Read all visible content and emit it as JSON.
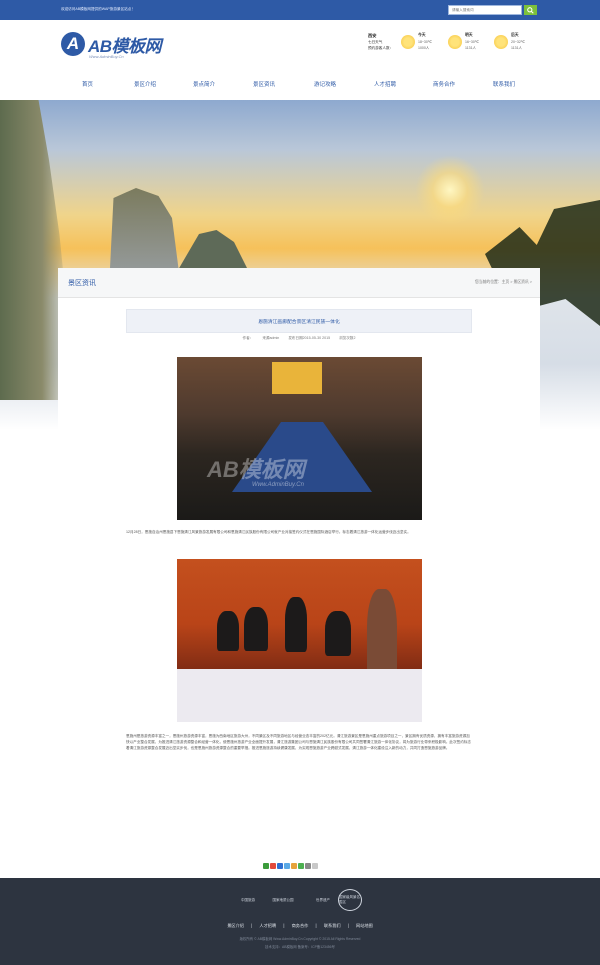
{
  "topbar": {
    "welcome": "欢迎访问AB模板网提供的WAP旅游景区站点！",
    "search_placeholder": "请输入搜索词"
  },
  "logo": {
    "name": "AB模板网",
    "url": "Www.AdminBuy.Cn"
  },
  "weather": {
    "city": "西安",
    "city_sub": "七日天气",
    "hint": "预约游客人数：",
    "days": [
      {
        "label": "今天",
        "temp": "18~30℃",
        "visitors": "1000人"
      },
      {
        "label": "明天",
        "temp": "16~30℃",
        "visitors": "1131人"
      },
      {
        "label": "后天",
        "temp": "20~32℃",
        "visitors": "1131人"
      }
    ]
  },
  "nav": [
    "首页",
    "景区介绍",
    "景点简介",
    "景区资讯",
    "游记攻略",
    "人才招聘",
    "商务合作",
    "联系我们"
  ],
  "section": {
    "title": "景区资讯",
    "breadcrumb": "您当前的位置：主页 > 景区资讯 >"
  },
  "article": {
    "title": "恩施清江画廊配合景区清江民族一体化",
    "meta": [
      "作者：",
      "来源admin",
      "发布日期2015-05-30 2015",
      "浏览次数2"
    ],
    "photo1_watermark": "AB模板网",
    "photo1_watermark_url": "Www.AdminBuy.Cn",
    "para1": "12月28日，恩施自治州恩施县下恩施清江风景旅游发展有限公司和恩施清江民族股份有限公司就产业对接签约仪式在恩施国际酒店举行。标志着清江旅游一体化运营步伐迈出坚实。",
    "para2": "恩施州是旅游资源丰富之一，恩施州旅游资源丰富，恩施为西南地区旅游大州，不同景区及不同旅游地区与经营业态丰富的202亿元。清江旅游景区是恩施州重点旅游项目之一，景区拥有优质资源，拥有丰富旅游资源加快以产业整合发展，为推进清江旅游资源整合和经营一体化，使恩施州旅游产业全面提升发展，清江旅游集团公司与恩施清江民族股份有限公司共同签署清江旅游一体化协议，将为旅游行业带来积极影响。此次签约标志着清江旅游资源整合发展迈出坚实步伐，也是恩施州旅游资源整合的重要举措。推进恩施旅游持续健康发展，为实现恩施旅游产业跨越式发展、清江旅游一体化建设注入新的动力，共同打造恩施旅游品牌。"
  },
  "share": {
    "colors": [
      "#3b9c3b",
      "#e24a3b",
      "#2e6fd1",
      "#5aa9e6",
      "#e6a23b",
      "#4caf50",
      "#888888",
      "#c8c8c8"
    ]
  },
  "footer": {
    "logos": [
      "中国旅游",
      "国家地质公园",
      "世界遗产",
      "国家级风景名胜区"
    ],
    "links": [
      "景区介绍",
      "|",
      "人才招聘",
      "|",
      "商务合作",
      "|",
      "联系我们",
      "|",
      "网站地图"
    ],
    "copyright": "版权所有 © AB模板网 Www.AdminBuy.Cn Copyright © 2015 All Rights Reserved",
    "icp": "技术支持：AB模板网 备案号：ICP备123456号"
  }
}
